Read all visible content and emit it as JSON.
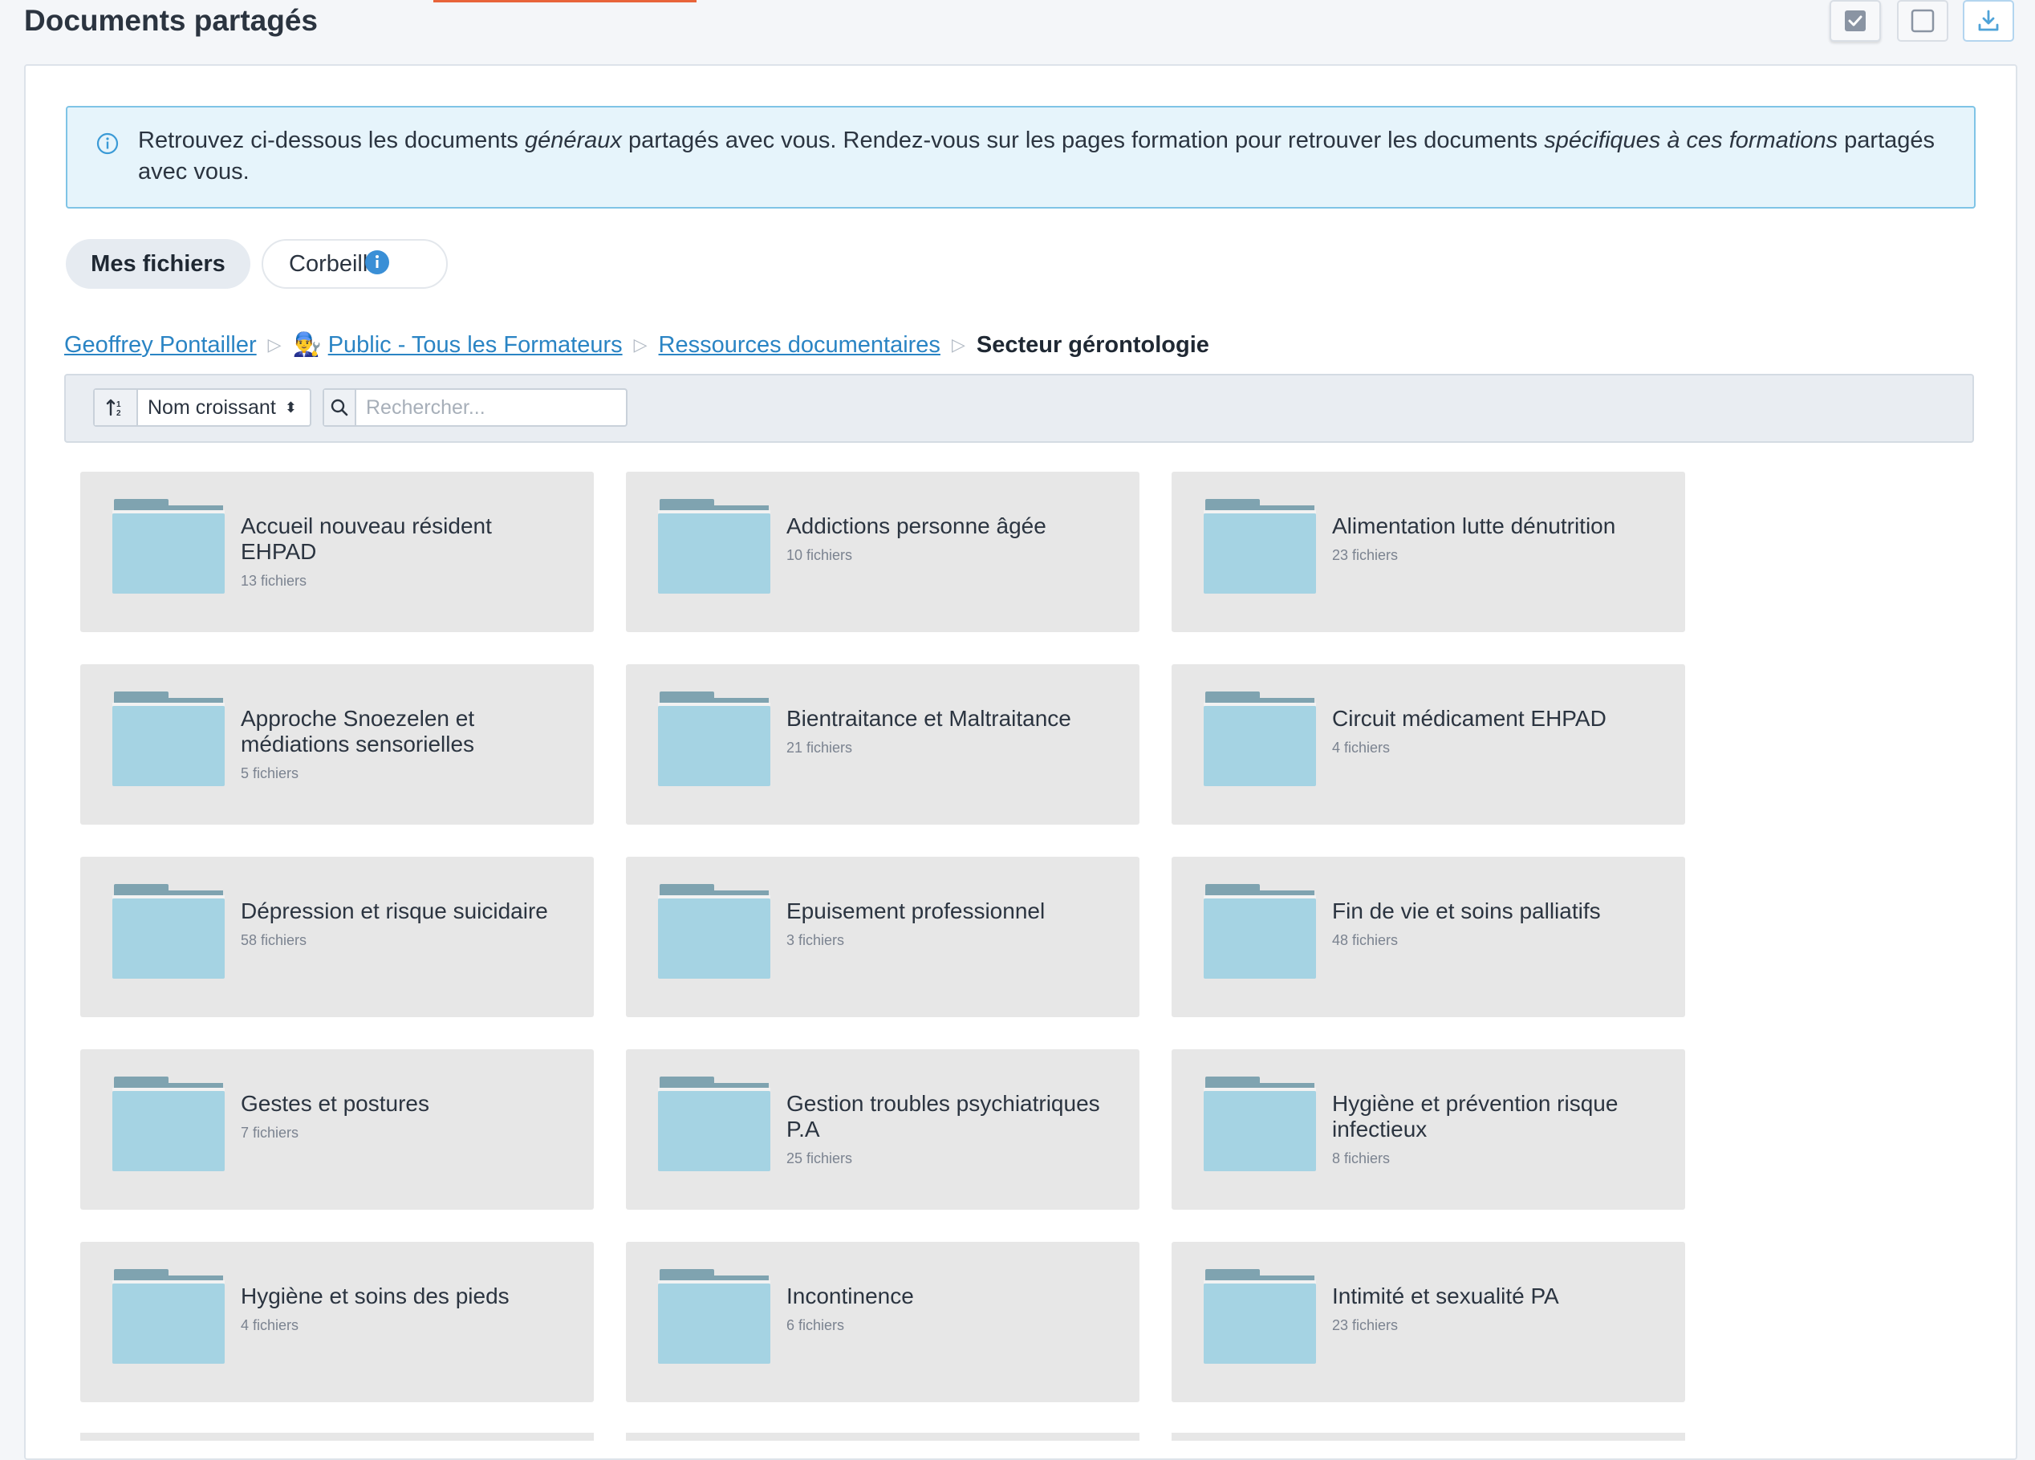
{
  "header": {
    "title": "Documents partagés",
    "select_all_icon": "checkbox-checked-icon",
    "deselect_icon": "checkbox-empty-icon",
    "download_icon": "download-icon"
  },
  "info": {
    "text_1": "Retrouvez ci-dessous les documents ",
    "text_em_1": "généraux",
    "text_2": " partagés avec vous. Rendez-vous sur les pages formation pour retrouver les documents ",
    "text_em_2": "spécifiques à ces formations",
    "text_3": " partagés avec vous."
  },
  "tabs": {
    "mine": "Mes fichiers",
    "trash": "Corbeille"
  },
  "breadcrumb": {
    "home": "Geoffrey Pontailler",
    "group_emoji": "👨‍🔧",
    "group": "Public - Tous les Formateurs",
    "resources": "Ressources documentaires",
    "current": "Secteur gérontologie"
  },
  "toolbar": {
    "sort_label": "Nom croissant",
    "search_placeholder": "Rechercher..."
  },
  "folders": [
    {
      "name": "Accueil nouveau résident EHPAD",
      "count": "13 fichiers"
    },
    {
      "name": "Addictions personne âgée",
      "count": "10 fichiers"
    },
    {
      "name": "Alimentation lutte dénutrition",
      "count": "23 fichiers"
    },
    {
      "name": "Approche Snoezelen et médiations sensorielles",
      "count": "5 fichiers"
    },
    {
      "name": "Bientraitance et Maltraitance",
      "count": "21 fichiers"
    },
    {
      "name": "Circuit médicament EHPAD",
      "count": "4 fichiers"
    },
    {
      "name": "Dépression et risque suicidaire",
      "count": "58 fichiers"
    },
    {
      "name": "Epuisement professionnel",
      "count": "3 fichiers"
    },
    {
      "name": "Fin de vie et soins palliatifs",
      "count": "48 fichiers"
    },
    {
      "name": "Gestes et postures",
      "count": "7 fichiers"
    },
    {
      "name": "Gestion troubles psychiatriques P.A",
      "count": "25 fichiers"
    },
    {
      "name": "Hygiène et prévention risque infectieux",
      "count": "8 fichiers"
    },
    {
      "name": "Hygiène et soins des pieds",
      "count": "4 fichiers"
    },
    {
      "name": "Incontinence",
      "count": "6 fichiers"
    },
    {
      "name": "Intimité et sexualité PA",
      "count": "23 fichiers"
    }
  ],
  "colors": {
    "accent": "#e8643a",
    "link": "#2a84c4",
    "folder_body": "#a5d3e3",
    "folder_tab": "#7fa3b0",
    "info_border": "#7fc4e6"
  }
}
